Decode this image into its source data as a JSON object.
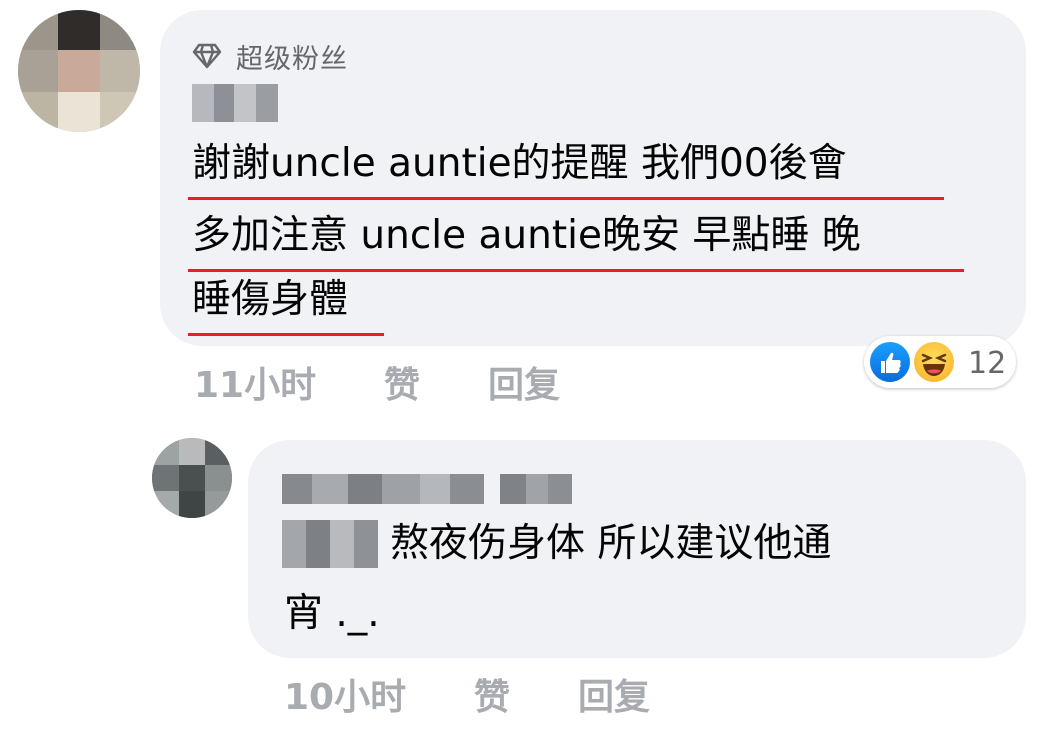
{
  "comment1": {
    "badge_label": "超级粉丝",
    "lines": [
      "謝謝uncle auntie的提醒 我們00後會",
      "多加注意 uncle auntie晚安 早點睡 晚",
      "睡傷身體"
    ],
    "time": "11小时",
    "like_label": "赞",
    "reply_label": "回复",
    "reaction_count": "12"
  },
  "comment2": {
    "text_line1": "熬夜伤身体 所以建议他通",
    "text_line2": "宵 ._.",
    "time": "10小时",
    "like_label": "赞",
    "reply_label": "回复"
  },
  "colors": {
    "bubble": "#f0f2f5",
    "meta_text": "#a8abb0",
    "underline": "#e41e2b",
    "like_blue": "#0a6cdc",
    "haha_yellow": "#f7b125"
  },
  "icons": [
    "diamond-icon",
    "like-reaction-icon",
    "haha-reaction-icon"
  ]
}
